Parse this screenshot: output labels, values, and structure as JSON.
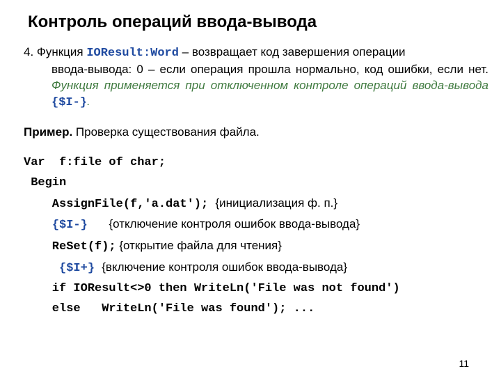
{
  "title": "Контроль операций ввода-вывода",
  "para": {
    "num": "4.",
    "pre": " Функция ",
    "func": "IOResult:Word",
    "post1": " – возвращает код завершения операции",
    "line2": "ввода-вывода: 0 – если операция прошла нормально, код ошибки, если нет. ",
    "green1": "Функция применяется при отключенном контроле операций ввода-вывода ",
    "directive": "{$I-}",
    "green2": "."
  },
  "example": {
    "label": "Пример.",
    "text": " Проверка существования файла."
  },
  "code": {
    "l1": "Var  f:file of char;",
    "l2": " Begin",
    "l3a": "    AssignFile(f,'a.dat'); ",
    "l3c": "{инициализация ф. п.}",
    "l4a": "    ",
    "l4d": "{$I-}",
    "l4sp": "   ",
    "l4c": "{отключение контроля ошибок ввода-вывода}",
    "l5a": "    ReSet(f);",
    "l5c": " {открытие файла для чтения}",
    "l6a": "     ",
    "l6d": "{$I+}",
    "l6sp": " ",
    "l6c": "{включение контроля ошибок ввода-вывода}",
    "l7": "    if IOResult<>0 then WriteLn('File was not found')",
    "l8": "    else   WriteLn('File was found'); ..."
  },
  "page": "11"
}
